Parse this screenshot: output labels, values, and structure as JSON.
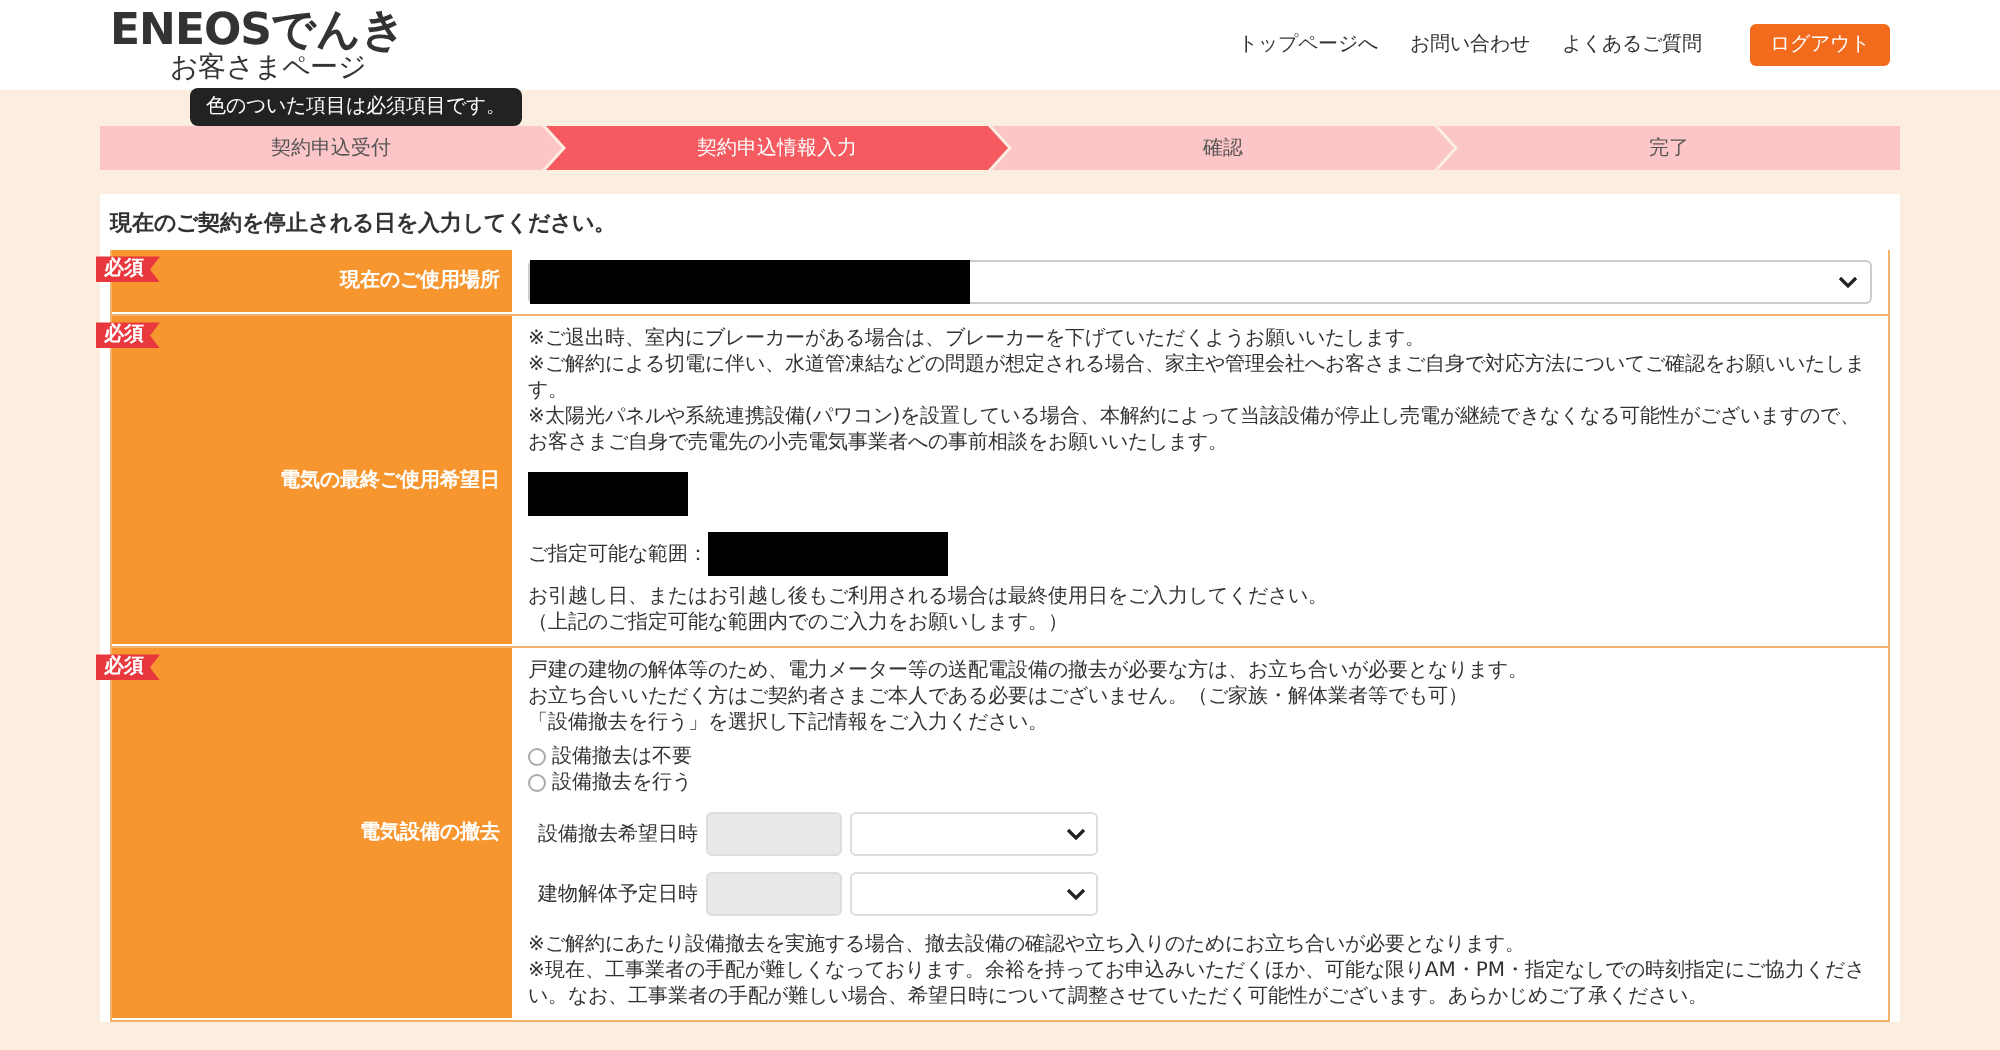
{
  "header": {
    "logo_main": "ENEOSでんき",
    "logo_sub": "お客さまページ",
    "nav": [
      "トップページへ",
      "お問い合わせ",
      "よくあるご質問"
    ],
    "logout": "ログアウト"
  },
  "tooltip": "色のついた項目は必須項目です。",
  "steps": [
    {
      "label": "契約申込受付",
      "selected": false
    },
    {
      "label": "契約申込情報入力",
      "selected": true
    },
    {
      "label": "確認",
      "selected": false
    },
    {
      "label": "完了",
      "selected": false
    }
  ],
  "form": {
    "heading": "現在のご契約を停止される日を入力してください。",
    "rows": [
      {
        "kind": "select",
        "required": true,
        "badge": "必須",
        "label": "現在のご使用場所"
      },
      {
        "kind": "date",
        "required": true,
        "badge": "必須",
        "label": "電気の最終ご使用希望日",
        "notes": [
          "※ご退出時、室内にブレーカーがある場合は、ブレーカーを下げていただくようお願いいたします。",
          "※ご解約による切電に伴い、水道管凍結などの問題が想定される場合、家主や管理会社へお客さまご自身で対応方法についてご確認をお願いいたします。",
          "※太陽光パネルや系統連携設備(パワコン)を設置している場合、本解約によって当該設備が停止し売電が継続できなくなる可能性がございますので、お客さまご自身で売電先の小売電気事業者への事前相談をお願いいたします。"
        ],
        "range_label": "ご指定可能な範囲：",
        "after": [
          "お引越し日、またはお引越し後もご利用される場合は最終使用日をご入力してください。",
          "（上記のご指定可能な範囲内でのご入力をお願いします。）"
        ]
      },
      {
        "kind": "removal",
        "required": true,
        "badge": "必須",
        "label": "電気設備の撤去",
        "intro": [
          "戸建の建物の解体等のため、電力メーター等の送配電設備の撤去が必要な方は、お立ち合いが必要となります。",
          "お立ち合いいただく方はご契約者さまご本人である必要はございません。（ご家族・解体業者等でも可）",
          "「設備撤去を行う」を選択し下記情報をご入力ください。"
        ],
        "options": [
          {
            "label": "設備撤去は不要",
            "checked": false
          },
          {
            "label": "設備撤去を行う",
            "checked": false
          }
        ],
        "datetimes": [
          {
            "label": "設備撤去希望日時"
          },
          {
            "label": "建物解体予定日時"
          }
        ],
        "notes": [
          "※ご解約にあたり設備撤去を実施する場合、撤去設備の確認や立ち入りのためにお立ち合いが必要となります。",
          "※現在、工事業者の手配が難しくなっております。余裕を持ってお申込みいただくほか、可能な限りAM・PM・指定なしでの時刻指定にご協力ください。なお、工事業者の手配が難しい場合、希望日時について調整させていただく可能性がございます。あらかじめご了承ください。"
        ]
      }
    ]
  }
}
